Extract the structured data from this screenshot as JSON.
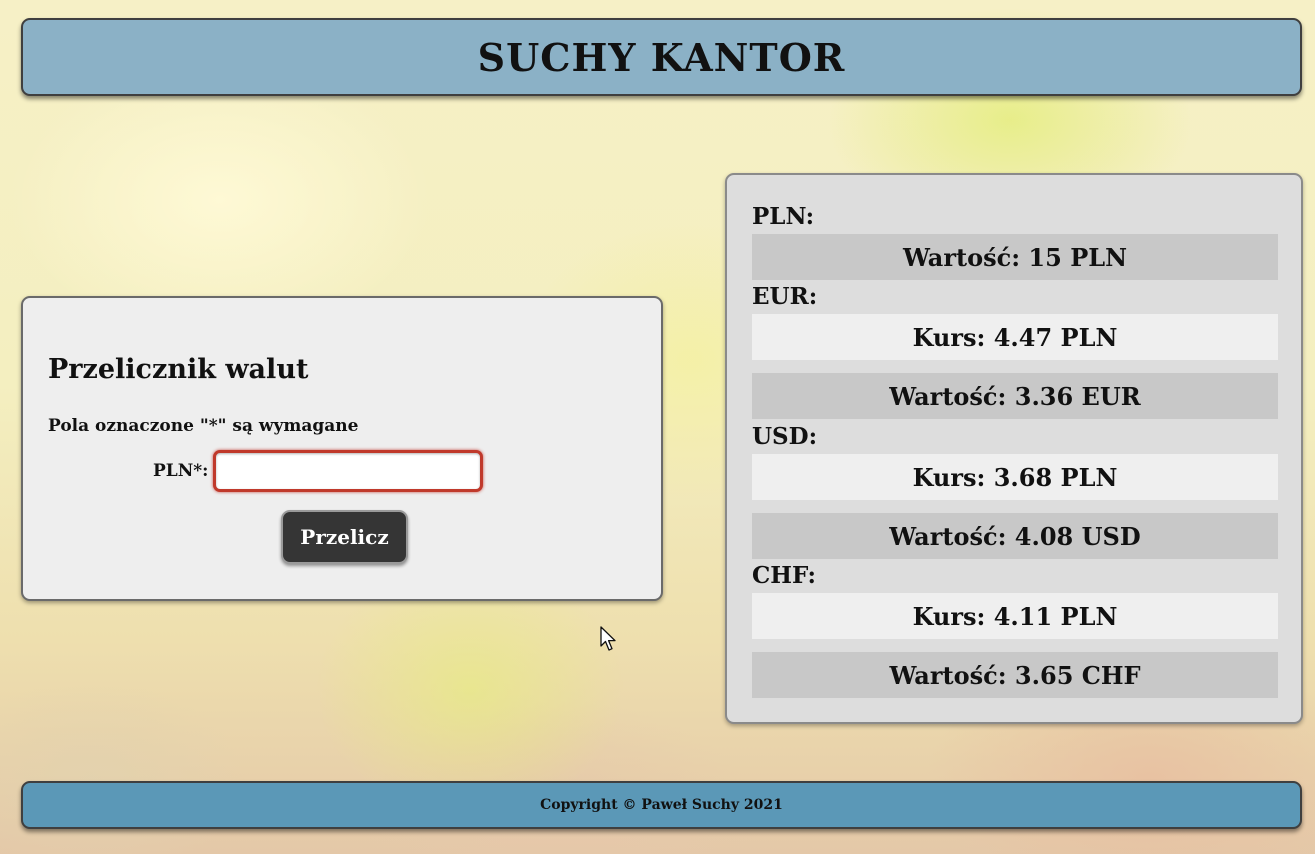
{
  "header": {
    "title": "SUCHY KANTOR"
  },
  "converter": {
    "title": "Przelicznik walut",
    "required_note": "Pola oznaczone \"*\" są wymagane",
    "field_label": "PLN*:",
    "field_value": "",
    "field_placeholder": "",
    "submit_label": "Przelicz"
  },
  "rates": {
    "pln": {
      "label": "PLN:",
      "value": "Wartość: 15 PLN"
    },
    "eur": {
      "label": "EUR:",
      "rate": "Kurs: 4.47 PLN",
      "value": "Wartość: 3.36 EUR"
    },
    "usd": {
      "label": "USD:",
      "rate": "Kurs: 3.68 PLN",
      "value": "Wartość: 4.08 USD"
    },
    "chf": {
      "label": "CHF:",
      "rate": "Kurs: 4.11 PLN",
      "value": "Wartość: 3.65 CHF"
    }
  },
  "footer": {
    "copyright": "Copyright © Paweł Suchy 2021"
  },
  "colors": {
    "header_bg": "#8bb1c6",
    "footer_bg": "#5b98b7",
    "button_bg": "#353535",
    "input_border_invalid": "#c0392b",
    "panel_bg": "#eeeeee",
    "rates_bg": "#dddddd"
  },
  "icons": {
    "cursor": "mouse-pointer-icon"
  }
}
